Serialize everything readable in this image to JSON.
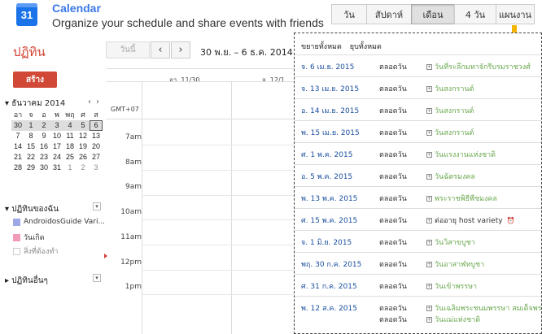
{
  "header": {
    "logo_text": "31",
    "app_title": "Calendar",
    "app_subtitle": "Organize your schedule and share events with friends"
  },
  "view_tabs": [
    {
      "label": "วัน",
      "selected": false
    },
    {
      "label": "สัปดาห์",
      "selected": false
    },
    {
      "label": "เดือน",
      "selected": true
    },
    {
      "label": "4 วัน",
      "selected": false
    },
    {
      "label": "แผนงาน",
      "selected": false
    }
  ],
  "accent_colors": {
    "arrow": "#f5b400",
    "create": "#d14836",
    "event_green": "#6aa84f",
    "date_blue": "#1a4fa0"
  },
  "sidebar": {
    "title": "ปฏิทิน",
    "create_label": "สร้าง",
    "mini_calendar": {
      "month_label": "ธันวาคม 2014",
      "prev": "‹",
      "next": "›",
      "days_of_week": [
        "อา",
        "จ",
        "อ",
        "พ",
        "พฤ",
        "ศ",
        "ส"
      ],
      "weeks": [
        [
          "30",
          "1",
          "2",
          "3",
          "4",
          "5",
          "6"
        ],
        [
          "7",
          "8",
          "9",
          "10",
          "11",
          "12",
          "13"
        ],
        [
          "14",
          "15",
          "16",
          "17",
          "18",
          "19",
          "20"
        ],
        [
          "21",
          "22",
          "23",
          "24",
          "25",
          "26",
          "27"
        ],
        [
          "28",
          "29",
          "30",
          "31",
          "1",
          "2",
          "3"
        ]
      ]
    },
    "my_calendars_title": "ปฏิทินของฉัน",
    "my_calendars": [
      {
        "label": "AndroidosGuide Vari...",
        "color": "#9fa8e6"
      },
      {
        "label": "วันเกิด",
        "color": "#f29bb9"
      },
      {
        "label": "สิ่งที่ต้องทำ",
        "color": ""
      }
    ],
    "other_calendars_title": "ปฏิทินอื่นๆ"
  },
  "toolbar": {
    "today_label": "วันนี้",
    "prev_label": "‹",
    "next_label": "›",
    "date_range": "30 พ.ย. – 6 ธ.ค. 2014"
  },
  "week_view": {
    "columns": [
      "อา. 11/30",
      "จ. 12/1"
    ],
    "timezone": "GMT+07",
    "hours": [
      "7am",
      "8am",
      "9am",
      "10am",
      "11am",
      "12pm",
      "1pm"
    ]
  },
  "agenda": {
    "expand_all": "ขยายทั้งหมด",
    "collapse_all": "ยุบทั้งหมด",
    "rows": [
      {
        "date": "จ. 6 เม.ย. 2015",
        "events": [
          {
            "time": "ตลอดวัน",
            "title": "วันที่ระลึกมหาจักรีบรมราชวงศ์",
            "dark": false
          }
        ]
      },
      {
        "date": "จ. 13 เม.ย. 2015",
        "events": [
          {
            "time": "ตลอดวัน",
            "title": "วันสงกรานต์",
            "dark": false
          }
        ]
      },
      {
        "date": "อ. 14 เม.ย. 2015",
        "events": [
          {
            "time": "ตลอดวัน",
            "title": "วันสงกรานต์",
            "dark": false
          }
        ]
      },
      {
        "date": "พ. 15 เม.ย. 2015",
        "events": [
          {
            "time": "ตลอดวัน",
            "title": "วันสงกรานต์",
            "dark": false
          }
        ]
      },
      {
        "date": "ศ. 1 พ.ค. 2015",
        "events": [
          {
            "time": "ตลอดวัน",
            "title": "วันแรงงานแห่งชาติ",
            "dark": false
          }
        ]
      },
      {
        "date": "อ. 5 พ.ค. 2015",
        "events": [
          {
            "time": "ตลอดวัน",
            "title": "วันฉัตรมงคล",
            "dark": false
          }
        ]
      },
      {
        "date": "พ. 13 พ.ค. 2015",
        "events": [
          {
            "time": "ตลอดวัน",
            "title": "พระราชพิธีพืชมงคล",
            "dark": false
          }
        ]
      },
      {
        "date": "ศ. 15 พ.ค. 2015",
        "events": [
          {
            "time": "ตลอดวัน",
            "title": "ต่ออายุ host variety",
            "dark": true
          }
        ]
      },
      {
        "date": "จ. 1 มิ.ย. 2015",
        "events": [
          {
            "time": "ตลอดวัน",
            "title": "วันวิสาขบูชา",
            "dark": false
          }
        ]
      },
      {
        "date": "พฤ. 30 ก.ค. 2015",
        "events": [
          {
            "time": "ตลอดวัน",
            "title": "วันอาสาฬหบูชา",
            "dark": false
          }
        ]
      },
      {
        "date": "ศ. 31 ก.ค. 2015",
        "events": [
          {
            "time": "ตลอดวัน",
            "title": "วันเข้าพรรษา",
            "dark": false
          }
        ]
      },
      {
        "date": "พ. 12 ส.ค. 2015",
        "events": [
          {
            "time": "ตลอดวัน",
            "title": "วันเฉลิมพระชนมพรรษา สมเด็จพระนางเจ้าฯ",
            "dark": false
          },
          {
            "time": "ตลอดวัน",
            "title": "วันแม่แห่งชาติ",
            "dark": false
          }
        ]
      }
    ]
  }
}
